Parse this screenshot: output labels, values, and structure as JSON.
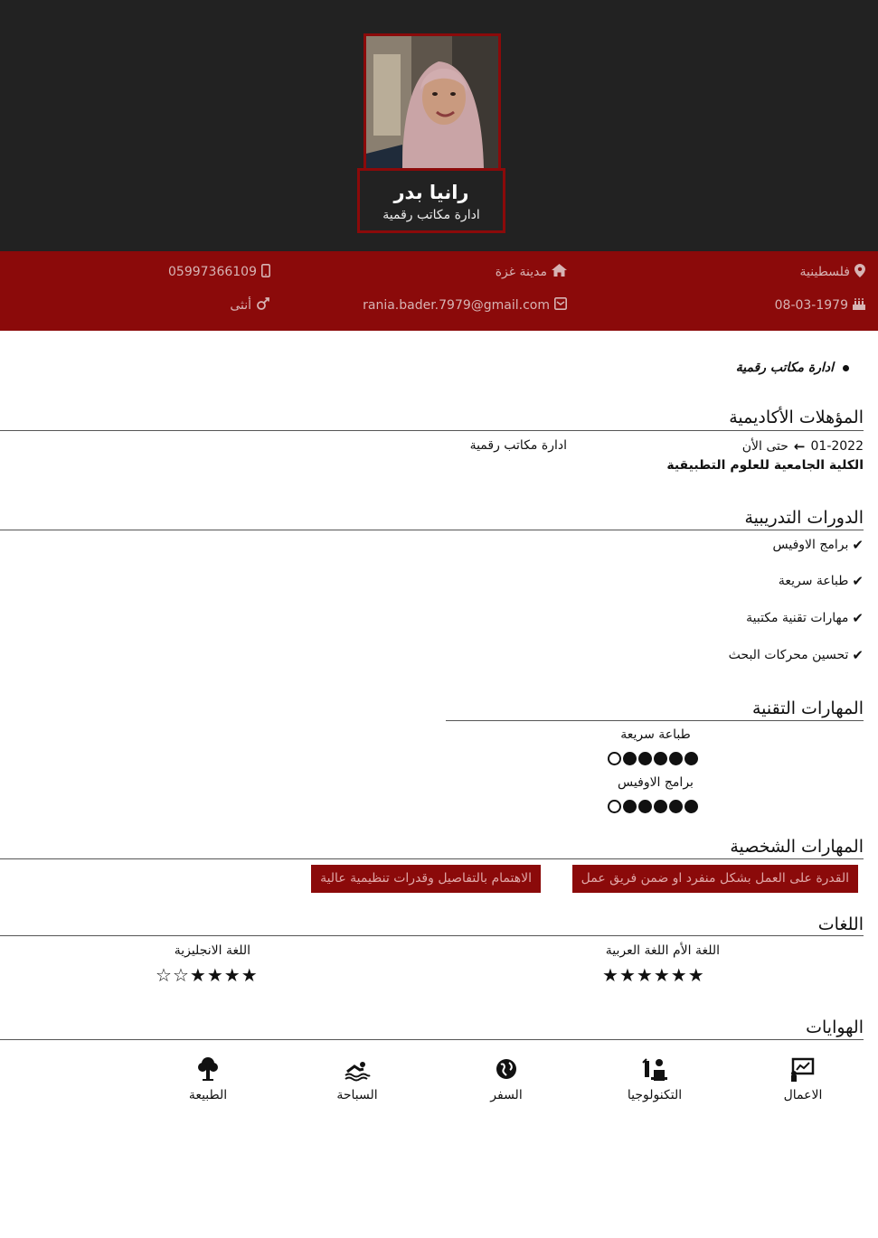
{
  "header": {
    "name": "رانيا بدر",
    "title": "ادارة مكاتب رقمية"
  },
  "contact": {
    "country": "فلسطينية",
    "city": "مدينة غزة",
    "phone": "05997366109",
    "birthdate": "08-03-1979",
    "email": "rania.bader.7979@gmail.com",
    "gender": "أنثى"
  },
  "objective": {
    "item": "ادارة مكاتب رقمية"
  },
  "education": {
    "heading": "المؤهلات الأكاديمية",
    "start": "01-2022",
    "end": "حتى الأن",
    "school": "الكلية الجامعية للعلوم التطبيقية",
    "major": "ادارة مكاتب رقمية"
  },
  "courses": {
    "heading": "الدورات التدريبية",
    "items": [
      "برامج الاوفيس",
      "طباعة سريعة",
      "مهارات تقنية مكتبية",
      "تحسين محركات البحث"
    ]
  },
  "tech_skills": {
    "heading": "المهارات التقنية",
    "items": [
      {
        "name": "طباعة سريعة",
        "level": 5,
        "max": 6
      },
      {
        "name": "برامج الاوفيس",
        "level": 5,
        "max": 6
      }
    ]
  },
  "personal_skills": {
    "heading": "المهارات الشخصية",
    "items": [
      "القدرة على العمل بشكل منفرد او ضمن فريق عمل",
      "الاهتمام بالتفاصيل وقدرات تنظيمية عالية"
    ]
  },
  "languages": {
    "heading": "اللغات",
    "items": [
      {
        "name": "اللغة الأم اللغة العربية",
        "stars": 6,
        "max": 6
      },
      {
        "name": "اللغة الانجليزية",
        "stars": 4,
        "max": 6
      }
    ]
  },
  "hobbies": {
    "heading": "الهوايات",
    "items": [
      {
        "label": "الاعمال",
        "icon": "business-icon"
      },
      {
        "label": "التكنولوجيا",
        "icon": "technology-icon"
      },
      {
        "label": "السفر",
        "icon": "travel-icon"
      },
      {
        "label": "السباحة",
        "icon": "swimming-icon"
      },
      {
        "label": "الطبيعة",
        "icon": "nature-icon"
      }
    ]
  },
  "colors": {
    "dark": "#222222",
    "accent": "#8b0a0a"
  }
}
